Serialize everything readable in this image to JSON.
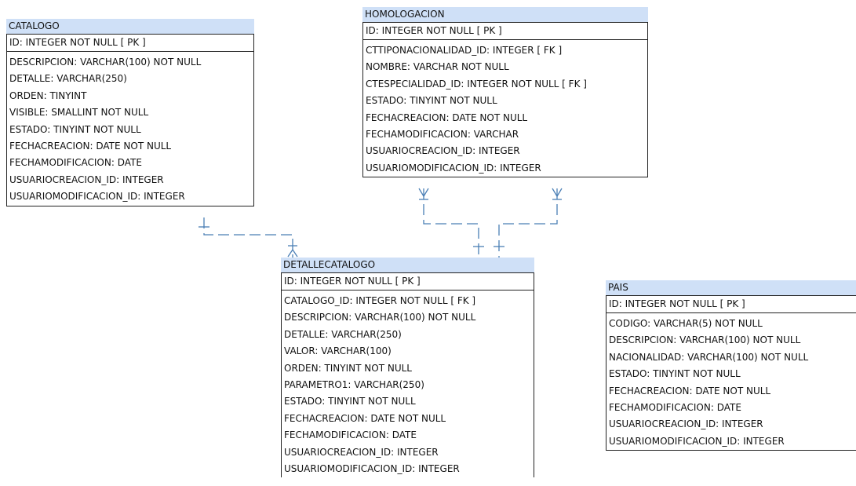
{
  "entities": {
    "catalogo": {
      "title": "CATALOGO",
      "pk": "ID: INTEGER   NOT NULL  [ PK ]",
      "columns": [
        "DESCRIPCION: VARCHAR(100)   NOT NULL",
        "DETALLE: VARCHAR(250)",
        "ORDEN: TINYINT",
        "VISIBLE: SMALLINT   NOT NULL",
        "ESTADO: TINYINT   NOT NULL",
        "FECHACREACION: DATE   NOT NULL",
        "FECHAMODIFICACION: DATE",
        "USUARIOCREACION_ID: INTEGER",
        "USUARIOMODIFICACION_ID: INTEGER"
      ]
    },
    "homologacion": {
      "title": "HOMOLOGACION",
      "pk": "ID: INTEGER   NOT NULL  [ PK ]",
      "columns": [
        "CTTIPONACIONALIDAD_ID: INTEGER  [ FK ]",
        "NOMBRE: VARCHAR   NOT NULL",
        "CTESPECIALIDAD_ID: INTEGER   NOT NULL  [ FK ]",
        "ESTADO: TINYINT   NOT NULL",
        "FECHACREACION: DATE   NOT NULL",
        "FECHAMODIFICACION: VARCHAR",
        "USUARIOCREACION_ID: INTEGER",
        "USUARIOMODIFICACION_ID: INTEGER"
      ]
    },
    "detallecatalogo": {
      "title": "DETALLECATALOGO",
      "pk": "ID: INTEGER   NOT NULL  [ PK ]",
      "columns": [
        "CATALOGO_ID: INTEGER   NOT NULL  [ FK ]",
        "DESCRIPCION: VARCHAR(100)   NOT NULL",
        "DETALLE: VARCHAR(250)",
        "VALOR: VARCHAR(100)",
        "ORDEN: TINYINT   NOT NULL",
        "PARAMETRO1: VARCHAR(250)",
        "ESTADO: TINYINT   NOT NULL",
        "FECHACREACION: DATE   NOT NULL",
        "FECHAMODIFICACION: DATE",
        "USUARIOCREACION_ID: INTEGER",
        "USUARIOMODIFICACION_ID: INTEGER"
      ]
    },
    "pais": {
      "title": "PAIS",
      "pk": "ID: INTEGER   NOT NULL  [ PK ]",
      "columns": [
        "CODIGO: VARCHAR(5)   NOT NULL",
        "DESCRIPCION: VARCHAR(100)   NOT NULL",
        "NACIONALIDAD: VARCHAR(100)   NOT NULL",
        "ESTADO: TINYINT   NOT NULL",
        "FECHACREACION: DATE   NOT NULL",
        "FECHAMODIFICACION: DATE",
        "USUARIOCREACION_ID: INTEGER",
        "USUARIOMODIFICACION_ID: INTEGER"
      ]
    }
  },
  "colors": {
    "header_fill": "#cfe0f7",
    "relationship_line": "#4a7fb5",
    "border": "#222222"
  }
}
